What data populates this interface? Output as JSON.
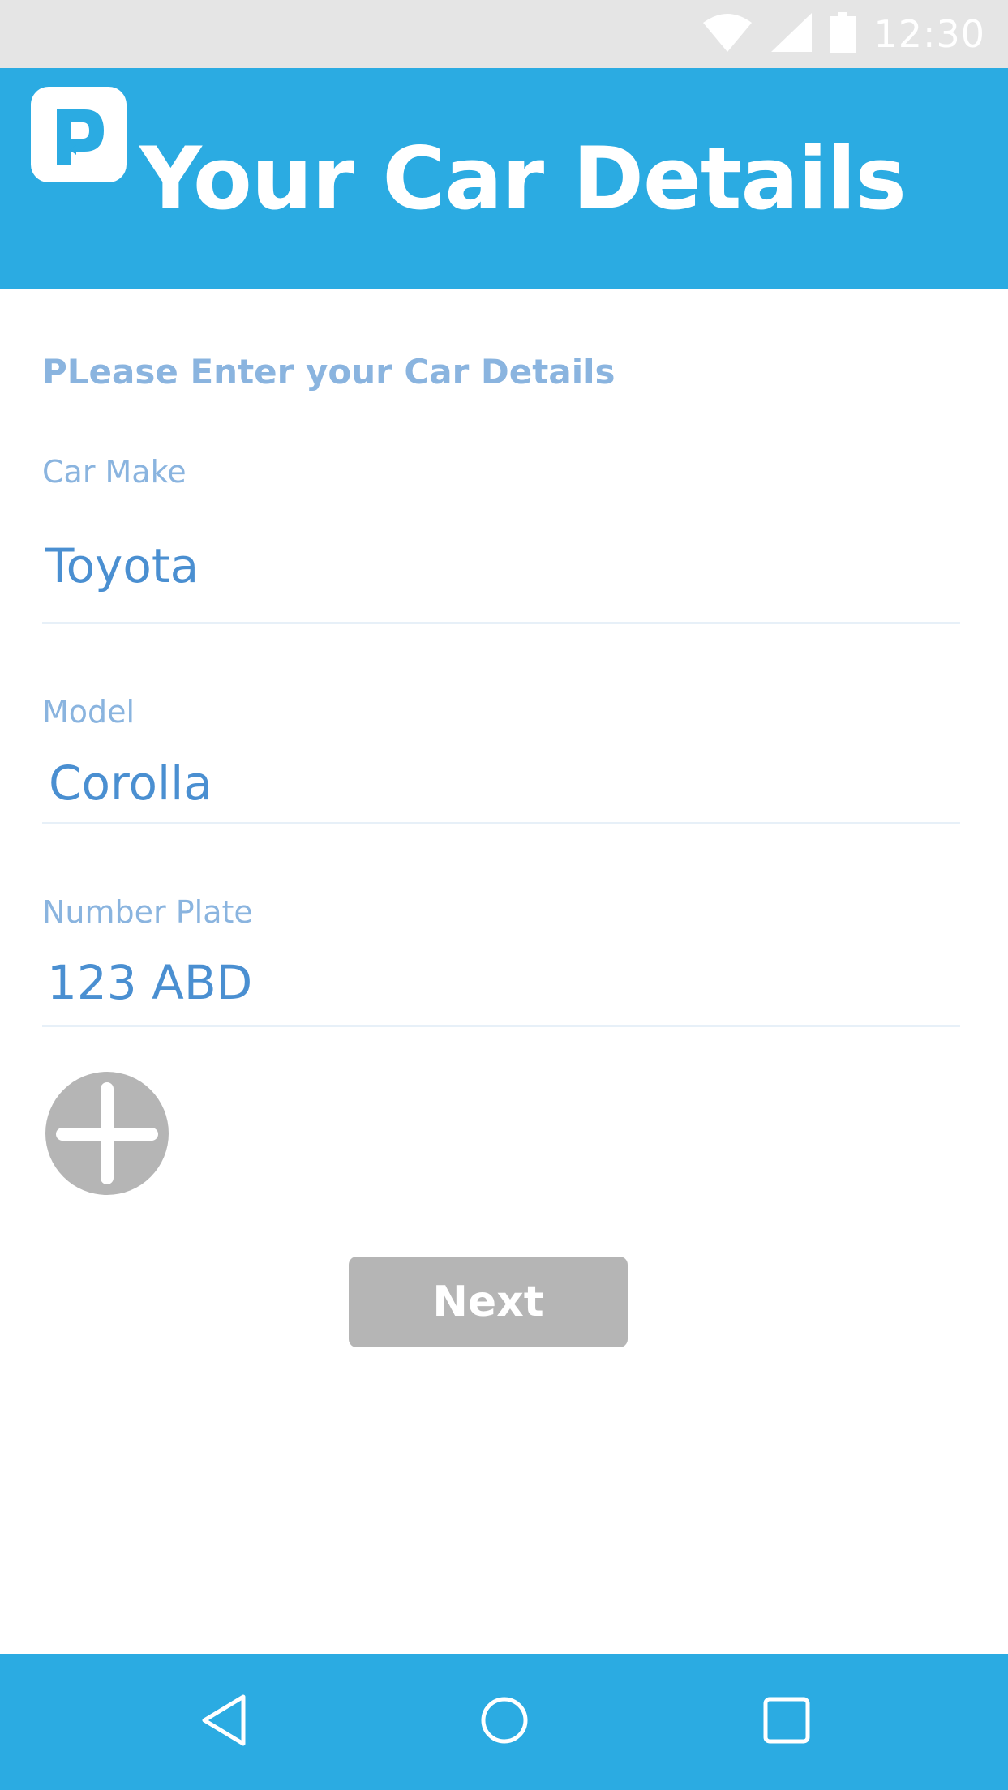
{
  "status_bar": {
    "time": "12:30",
    "icons": [
      "wifi-icon",
      "cell-signal-icon",
      "battery-icon"
    ]
  },
  "app_bar": {
    "logo": "parking-p-logo",
    "title": "Your Car Details"
  },
  "form": {
    "heading": "PLease Enter your Car Details",
    "fields": [
      {
        "label": "Car Make",
        "value": "Toyota"
      },
      {
        "label": "Model",
        "value": "Corolla"
      },
      {
        "label": "Number Plate",
        "value": "123 ABD"
      }
    ],
    "add_icon": "plus-icon",
    "next_label": "Next"
  },
  "nav_bar": {
    "icons": [
      "back-triangle-icon",
      "home-circle-icon",
      "recents-square-icon"
    ]
  },
  "colors": {
    "primary": "#2babe2",
    "label": "#8ab4df",
    "value": "#4a8fd1",
    "button_gray": "#b5b5b5",
    "status_bar": "#e5e5e5"
  }
}
